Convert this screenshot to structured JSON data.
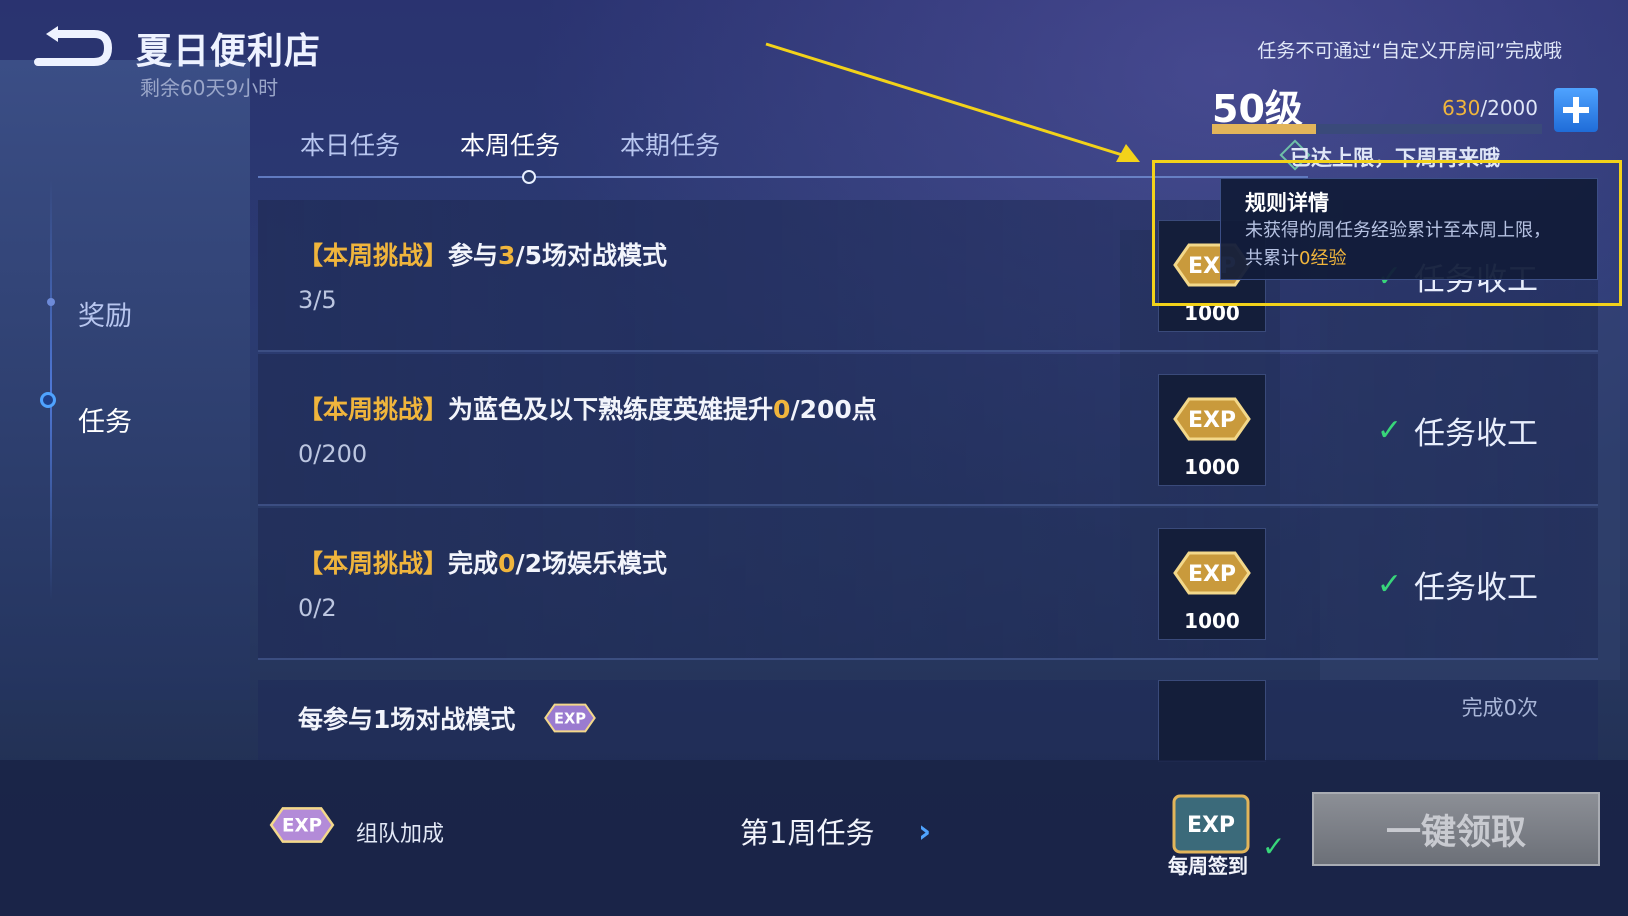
{
  "header": {
    "title": "夏日便利店",
    "subtitle": "剩余60天9小时",
    "notice": "任务不可通过“自定义开房间”完成哦"
  },
  "level": {
    "label": "50级",
    "exp_current": "630",
    "exp_max": "/2000",
    "progress": 0.315,
    "limit_text": "已达上限，下周再来哦"
  },
  "tabs": [
    {
      "label": "本日任务"
    },
    {
      "label": "本周任务"
    },
    {
      "label": "本期任务"
    }
  ],
  "sidebar": {
    "items": [
      {
        "label": "奖励"
      },
      {
        "label": "任务"
      }
    ]
  },
  "tasks": [
    {
      "tag": "【本周挑战】",
      "prefix": "参与",
      "num": "3",
      "rest": "/5场对战模式",
      "progress": "3/5",
      "reward": "1000",
      "status": "任务收工"
    },
    {
      "tag": "【本周挑战】",
      "prefix": "为蓝色及以下熟练度英雄提升",
      "num": "0",
      "rest": "/200点",
      "progress": "0/200",
      "reward": "1000",
      "status": "任务收工"
    },
    {
      "tag": "【本周挑战】",
      "prefix": "完成",
      "num": "0",
      "rest": "/2场娱乐模式",
      "progress": "0/2",
      "reward": "1000",
      "status": "任务收工"
    }
  ],
  "last_task": {
    "title": "每参与1场对战模式",
    "status": "完成0次"
  },
  "tooltip": {
    "title": "规则详情",
    "body_line1": "未获得的周任务经验累计至本周上限，",
    "body_prefix": "共累计",
    "body_highlight": "0经验"
  },
  "bottom": {
    "team_bonus": "组队加成",
    "week_label": "第1周任务",
    "weekly_sign": "每周签到",
    "claim_all": "一键领取"
  },
  "icons": {
    "back": "back-arrow-icon",
    "plus": "plus-icon",
    "exp": "exp-badge-icon",
    "check": "check-icon",
    "chevron": "chevron-right-icon"
  },
  "colors": {
    "accent_gold": "#f0b53c",
    "accent_blue": "#4fa3ff",
    "check_green": "#38d67a",
    "highlight_yellow": "#f2d21a"
  }
}
